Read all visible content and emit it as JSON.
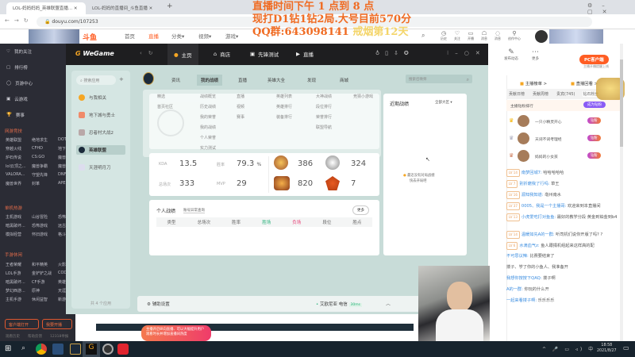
{
  "browser": {
    "tabs": [
      {
        "label": "LOL-妈妈妈妈_英雄联盟直播..."
      },
      {
        "label": "LOL-妈妈的直播间_斗鱼直播"
      }
    ],
    "new_tab": "+",
    "url": "douyu.com/107253"
  },
  "overlay": {
    "line1": "直播时间下午 1 点到 8 点",
    "line2": "现打D1钻1钻2局.大号目前570分",
    "line3a": "QQ群:643098141",
    "line3b": "戒烟第12天"
  },
  "douyu": {
    "logo": "斗鱼",
    "nav": [
      "首页",
      "直播",
      "分类▾",
      "视频▾",
      "游戏▾"
    ],
    "icons": [
      {
        "name": "history",
        "label": "历史"
      },
      {
        "name": "follow",
        "label": "关注"
      },
      {
        "name": "broadcast",
        "label": "开播"
      },
      {
        "name": "messages",
        "label": "消息"
      },
      {
        "name": "notify",
        "label": "消息"
      },
      {
        "name": "creator",
        "label": "创作中心"
      }
    ]
  },
  "sidebar": {
    "items": [
      "我的关注",
      "排行榜",
      "页游中心",
      "云游戏",
      "赛事"
    ],
    "sections": [
      {
        "title": "网游竞技",
        "games": [
          "英雄联盟",
          "绝地求生",
          "DOTA2",
          "穿越火线",
          "CFHD",
          "地下城",
          "炉石传说",
          "CS:GO",
          "魔兽争霸",
          "lol云顶之...",
          "魔兽争霸",
          "魔兽争霸",
          "VALORA...",
          "守望先锋",
          "DNF",
          "魔兽世界",
          "封革",
          "APEX"
        ]
      },
      {
        "title": "单机热游",
        "games": [
          "主机游戏",
          "山谷冒险",
          "恐怖游戏",
          "暗黑破坏...",
          "恐怖游戏",
          "远古浸卷",
          "模拟经营",
          "怀旧游戏",
          "格斗"
        ]
      },
      {
        "title": "手游休闲",
        "games": [
          "王者荣耀",
          "和平精英",
          "火影",
          "LOL手游",
          "金铲铲之战",
          "COD",
          "暗黑破坏...",
          "CF手游",
          "英雄之刃",
          "梦幻西游...",
          "原神",
          "天涯",
          "主机手游",
          "休闲益智",
          "新游"
        ]
      }
    ],
    "btn_client": "客户端打开",
    "btn_live": "我要开播",
    "footer": [
      "观看历史",
      "帮助反馈",
      "12318举报"
    ]
  },
  "wegame": {
    "logo": "WeGame",
    "nav": [
      "主页",
      "商店",
      "先锋测试",
      "直播"
    ],
    "search_placeholder": "搜索应用",
    "apps": [
      "与我相关",
      "地下城与勇士",
      "忍者村大战2",
      "英雄联盟",
      "天涯明月刀"
    ],
    "app_count": "共 4 个应用",
    "subtabs": [
      "资讯",
      "我的战绩",
      "直播",
      "英雄大全",
      "发现",
      "商城"
    ],
    "active_subtab": 1,
    "game_search_placeholder": "搜索召唤师",
    "dropdown": [
      [
        "精选",
        "首页社区"
      ],
      [
        "战绩概览",
        "历史战绩",
        "我的荣誉",
        "我的战绩",
        "个人荣誉",
        "实力测试"
      ],
      [
        "直播",
        "视频",
        "赛事"
      ],
      [
        "英雄列表",
        "英雄排行",
        "装备排行"
      ],
      [
        "大神战绩",
        "段位排行",
        "荣誉排行",
        "联盟导航"
      ],
      [
        "竞猜小游戏"
      ]
    ],
    "stats": {
      "kda_label": "KDA",
      "kda": "13.5",
      "winrate_label": "胜率",
      "winrate": "79.3",
      "pct": "%",
      "total_label": "总场次",
      "total": "333",
      "mvp_label": "MVP",
      "mvp": "29",
      "badges": [
        "386",
        "324",
        "820",
        "7"
      ]
    },
    "personal": {
      "title": "个人战绩",
      "link": "账号异常查询",
      "more": "更多",
      "headers": [
        "类型",
        "总场次",
        "胜率",
        "胜场",
        "负场",
        "段位",
        "胜点"
      ]
    },
    "recent": {
      "title": "近期战绩",
      "filter": "全部大区 ▾",
      "empty1": "最近没有对局战绩",
      "empty2": "快去开局吧"
    },
    "footer": {
      "assist": "辅助设置",
      "server": "艾欧尼亚 电信",
      "ping": "30ms"
    }
  },
  "chat": {
    "post": "发布动态",
    "more": "更多",
    "pc_client": "PC客户端",
    "pc_sub": "主播开播提醒上线",
    "rank": "主播榜单 >",
    "replay": "直播回看 >",
    "tabs": [
      "贡献日榜",
      "贡献周榜",
      "贵宾(745)",
      "钻石粉丝"
    ],
    "fans_title": "主播钻粉排行",
    "become_fan": "成为钻粉",
    "fans": [
      {
        "name": "一只小精灵开心",
        "badge": "钻粉"
      },
      {
        "name": "天词不词考理经",
        "badge": "钻粉"
      },
      {
        "name": "妈妈的小女孩",
        "badge": "钻粉"
      }
    ],
    "messages": [
      {
        "lv": "LV 14",
        "user": "南梦回城7:",
        "text": "哈哈哈哈哈"
      },
      {
        "lv": "LV 7",
        "user": "别折磨我了行吗:",
        "text": "草王"
      },
      {
        "lv": "LV 16",
        "user": "源知我知道:",
        "text": "亳州南水"
      },
      {
        "lv": "LV 37",
        "user": "0005、我是一个主播哥:",
        "text": "欢迎来到本直播间"
      },
      {
        "lv": "LV 13",
        "user": "小虎爱吃打对鱼鱼:",
        "text": "最好的教学分段 黄金到铂金到b4"
      },
      {
        "lv": "LV 14",
        "user": "温暖如先A的一群:",
        "text": "听司机们说你开版了吗? ?"
      },
      {
        "lv": "LV 6",
        "user": "水滴血气z:",
        "text": "鱼人跟捐机组起来这样高的配"
      },
      {
        "lv": "",
        "user": "不可思议辣:",
        "text": "比赛要结束了"
      },
      {
        "lv": "",
        "user": "",
        "text": "搂子、学了你的小鱼人、我准备开"
      },
      {
        "lv": "",
        "user": "我想你按按下QAQ:",
        "text": "搂子啊"
      },
      {
        "lv": "",
        "user": "A的一群:",
        "text": "你玩的什么开"
      },
      {
        "lv": "",
        "user": "一起来看搂子啊:",
        "text": "乐乐乐乐"
      }
    ]
  },
  "popup": {
    "text": "主播开启纵向直播、可以大幅提升用户观看时长并增加直播间热度"
  },
  "taskbar": {
    "time": "18:58",
    "date": "2021/8/27",
    "ime": "中"
  },
  "colors": {
    "douyu_orange": "#ff5d23",
    "overlay_orange": "#f06b22",
    "overlay_yellow": "#f4d56a",
    "wegame_bg": "#c8dcd8",
    "taskbar": "#17232d"
  }
}
